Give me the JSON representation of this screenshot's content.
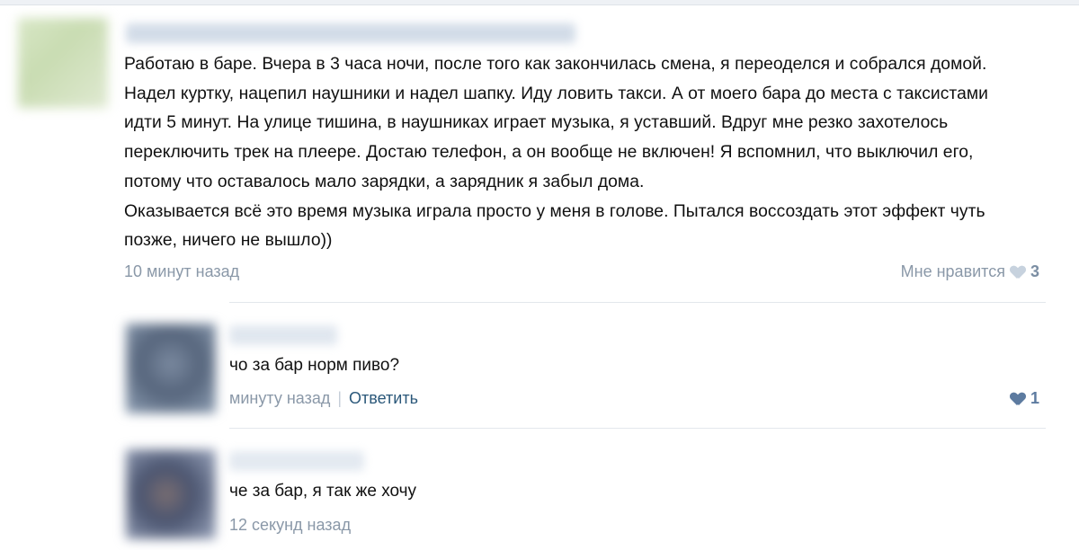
{
  "post": {
    "lines": [
      "Работаю в баре. Вчера в 3 часа ночи, после того как закончилась смена, я переоделся и собрался домой.",
      "Надел куртку, нацепил наушники и надел шапку. Иду ловить такси. А от моего бара до места с таксистами",
      "идти 5 минут. На улице тишина, в наушниках играет музыка, я уставший. Вдруг мне резко захотелось",
      "переключить трек на плеере. Достаю телефон, а он вообще не включен! Я вспомнил, что выключил его,",
      "потому что оставалось мало зарядки, а зарядник я забыл дома.",
      "Оказывается всё это время музыка играла просто у меня в голове. Пытался воссоздать этот эффект чуть",
      "позже, ничего не вышло))"
    ],
    "time": "10 минут назад",
    "like_label": "Мне нравится",
    "like_count": "3"
  },
  "comments": [
    {
      "text": "чо за бар норм пиво?",
      "time": "минуту назад",
      "separator": "|",
      "reply_label": "Ответить",
      "like_count": "1"
    },
    {
      "text": "че за бар, я так же хочу",
      "time": "12 секунд назад"
    }
  ],
  "colors": {
    "link": "#2b587a",
    "meta": "#8a98a8",
    "like_active": "#5d7ba0"
  }
}
